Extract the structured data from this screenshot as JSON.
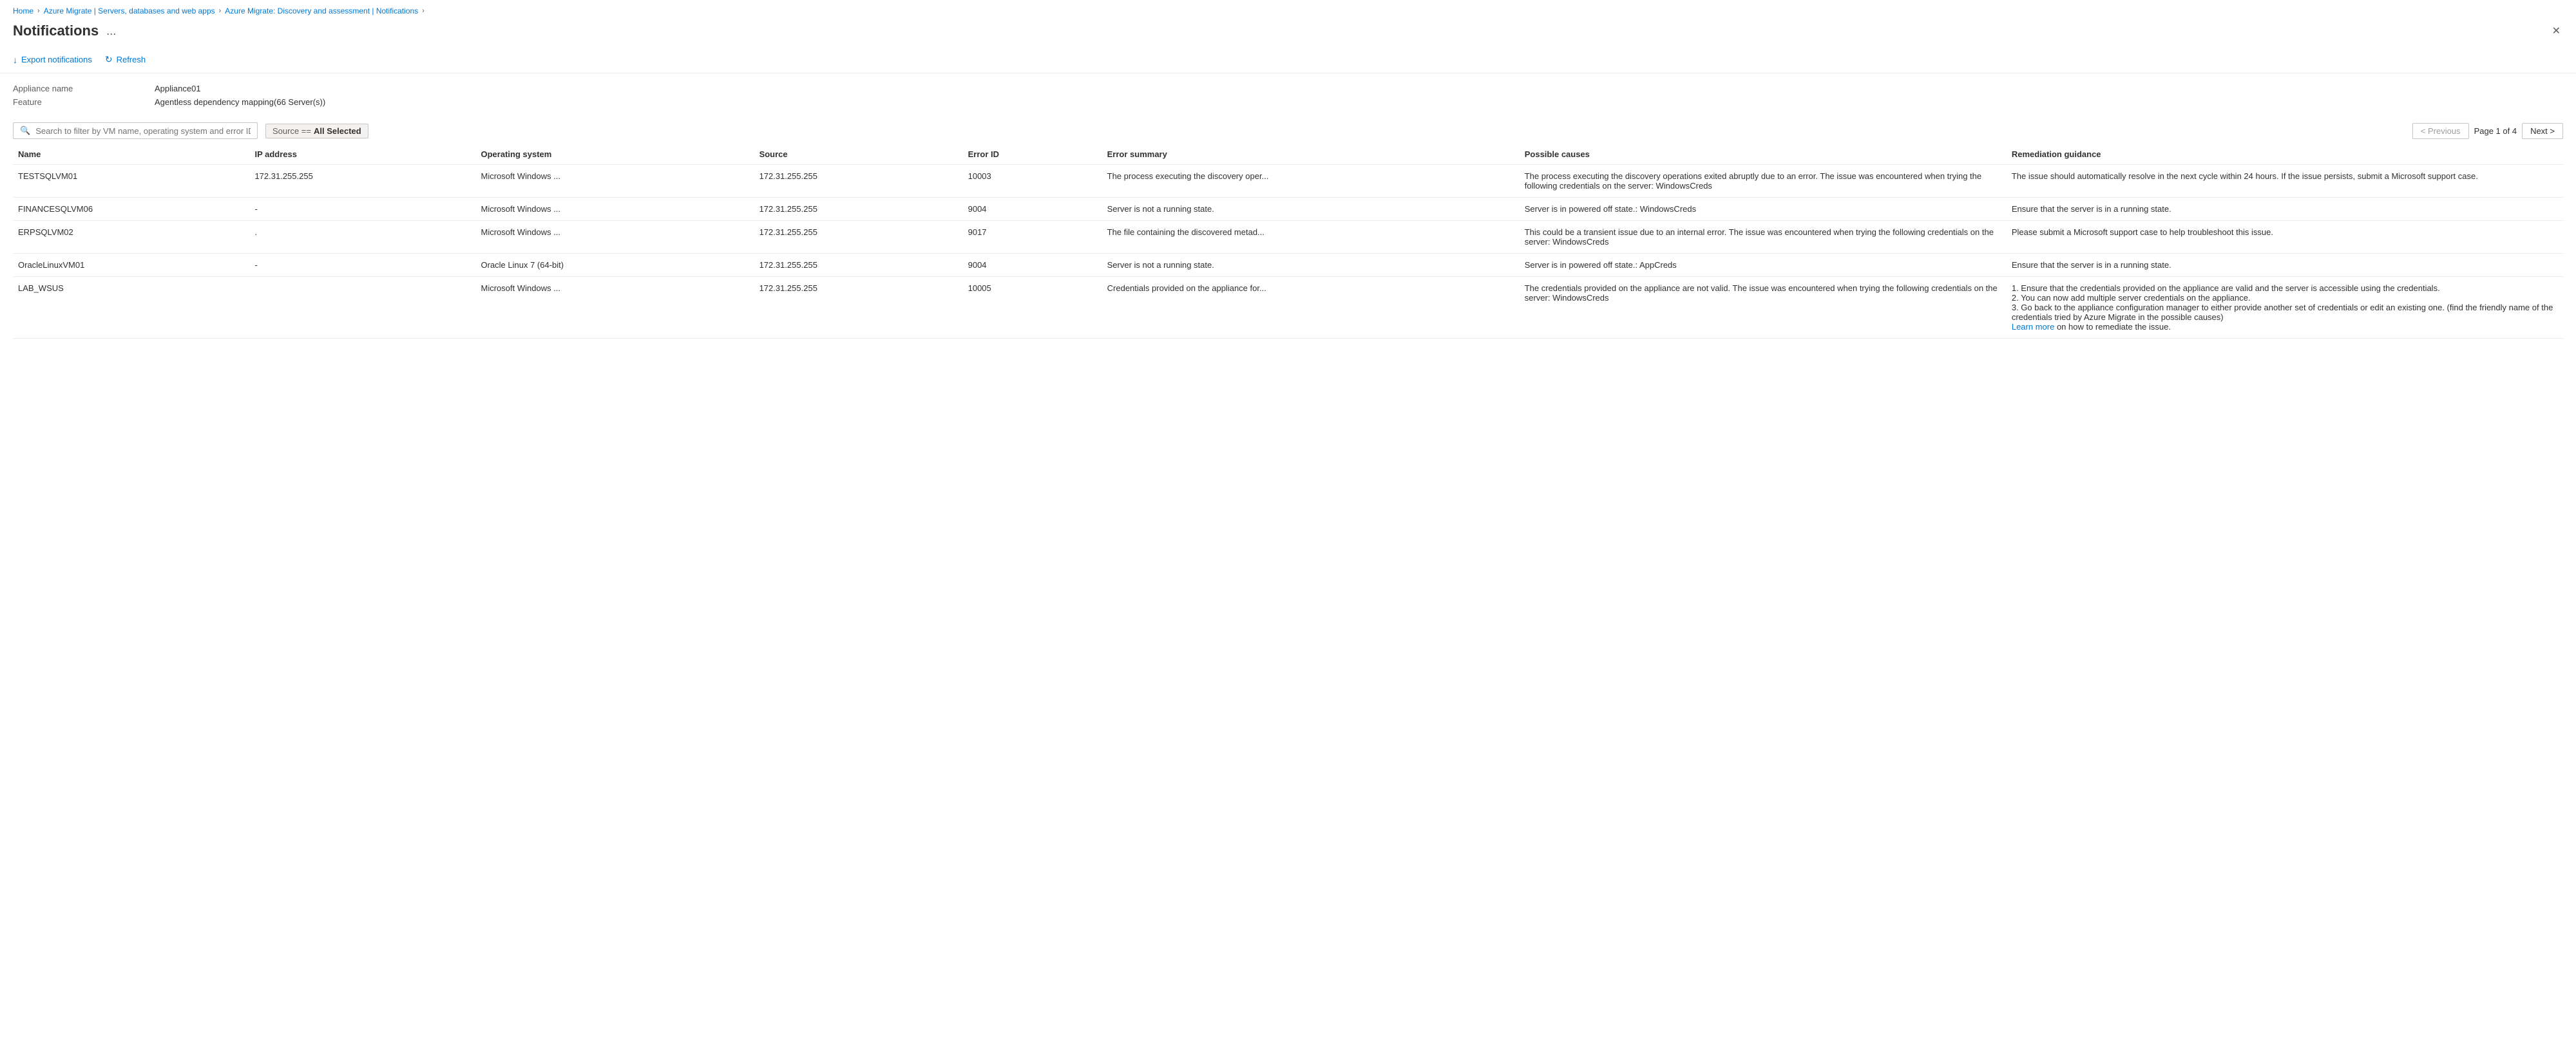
{
  "breadcrumb": {
    "items": [
      {
        "label": "Home",
        "href": "#"
      },
      {
        "label": "Azure Migrate | Servers, databases and web apps",
        "href": "#"
      },
      {
        "label": "Azure Migrate: Discovery and assessment | Notifications",
        "href": "#"
      }
    ],
    "separators": [
      ">",
      ">",
      ">"
    ]
  },
  "header": {
    "title": "Notifications",
    "dots_label": "...",
    "close_label": "✕"
  },
  "toolbar": {
    "export_label": "Export notifications",
    "export_icon": "↓",
    "refresh_label": "Refresh",
    "refresh_icon": "↻"
  },
  "meta": {
    "appliance_label": "Appliance name",
    "appliance_value": "Appliance01",
    "feature_label": "Feature",
    "feature_value": "Agentless dependency mapping(66 Server(s))"
  },
  "filter": {
    "search_placeholder": "Search to filter by VM name, operating system and error ID",
    "search_icon": "🔍",
    "tag": {
      "prefix": "Source ==",
      "value": "All Selected"
    }
  },
  "pagination": {
    "previous_label": "< Previous",
    "next_label": "Next >",
    "page_info": "Page 1 of 4"
  },
  "table": {
    "headers": [
      "Name",
      "IP address",
      "Operating system",
      "Source",
      "Error ID",
      "Error summary",
      "Possible causes",
      "Remediation guidance"
    ],
    "rows": [
      {
        "name": "TESTSQLVM01",
        "ip": "172.31.255.255",
        "os": "Microsoft Windows ...",
        "source": "172.31.255.255",
        "error_id": "10003",
        "summary": "The process executing the discovery oper...",
        "causes": "The process executing the discovery operations exited abruptly due to an error. The issue was encountered when trying the following credentials on the server: WindowsCreds",
        "remediation": "The issue should automatically resolve in the next cycle within 24 hours. If the issue persists, submit a Microsoft support case."
      },
      {
        "name": "FINANCESQLVM06",
        "ip": "-",
        "os": "Microsoft Windows ...",
        "source": "172.31.255.255",
        "error_id": "9004",
        "summary": "Server is not a running state.",
        "causes": "Server is in powered off state.: WindowsCreds",
        "remediation": "Ensure that the server is in a running state."
      },
      {
        "name": "ERPSQLVM02",
        "ip": ".",
        "os": "Microsoft Windows ...",
        "source": "172.31.255.255",
        "error_id": "9017",
        "summary": "The file containing the discovered metad...",
        "causes": "This could be a transient issue due to an internal error. The issue was encountered when trying the following credentials on the server: WindowsCreds",
        "remediation": "Please submit a Microsoft support case to help troubleshoot this issue."
      },
      {
        "name": "OracleLinuxVM01",
        "ip": "-",
        "os": "Oracle Linux 7 (64-bit)",
        "source": "172.31.255.255",
        "error_id": "9004",
        "summary": "Server is not a running state.",
        "causes": "Server is in powered off state.: AppCreds",
        "remediation": "Ensure that the server is in a running state."
      },
      {
        "name": "LAB_WSUS",
        "ip": "",
        "os": "Microsoft Windows ...",
        "source": "172.31.255.255",
        "error_id": "10005",
        "summary": "Credentials provided on the appliance for...",
        "causes": "The credentials provided on the appliance are not valid. The issue was encountered when trying the following credentials on the server: WindowsCreds",
        "remediation": "1. Ensure that the credentials provided on the appliance are valid and the server is accessible using the credentials.\n2. You can now add multiple server credentials on the appliance.\n3. Go back to the appliance configuration manager to either provide another set of credentials or edit an existing one. (find the friendly name of the credentials tried by Azure Migrate in the possible causes)",
        "remediation_link": "Learn more",
        "remediation_link_suffix": " on how to remediate the issue."
      }
    ]
  }
}
